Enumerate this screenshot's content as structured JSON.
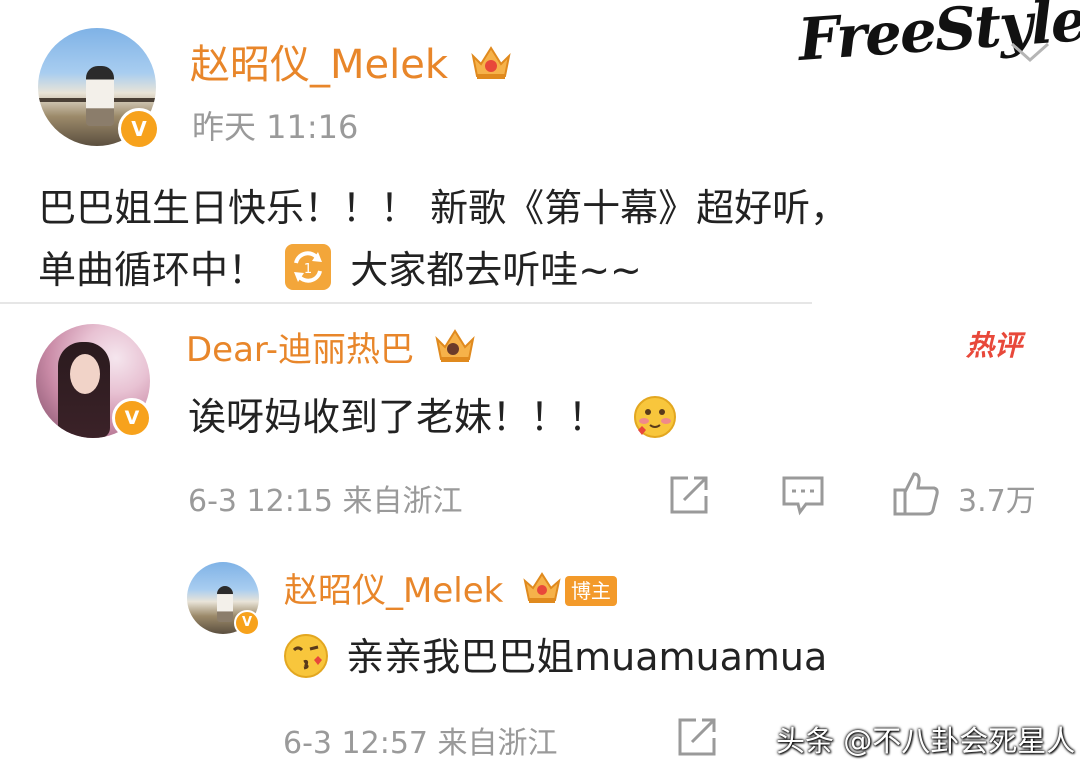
{
  "post": {
    "author": "赵昭仪_Melek",
    "time": "昨天 11:16",
    "content_line1": "巴巴姐生日快乐！！！  新歌《第十幕》超好听，",
    "content_line2_a": "单曲循环中！",
    "content_line2_b": "大家都去听哇~~",
    "verified_mark": "V"
  },
  "header": {
    "brand": "FreeStyle"
  },
  "comment": {
    "author": "Dear-迪丽热巴",
    "text": "诶呀妈收到了老妹！！！",
    "meta": "6-3 12:15 来自浙江",
    "likes": "3.7万",
    "hot_label": "热评",
    "verified_mark": "V"
  },
  "reply": {
    "author": "赵昭仪_Melek",
    "badge": "博主",
    "text": "亲亲我巴巴姐muamuamua",
    "meta": "6-3 12:57 来自浙江",
    "verified_mark": "V"
  },
  "watermark": {
    "text": "头条 @不八卦会死星人"
  },
  "colors": {
    "accent": "#e8862a",
    "verified": "#f7a21c",
    "hot": "#e8483a",
    "muted": "#9a9a9a"
  },
  "icons": {
    "repost": "share-icon",
    "comment": "comment-icon",
    "like": "thumbs-up-icon",
    "loop": "repeat-one-icon",
    "chevron": "chevron-down-icon"
  }
}
